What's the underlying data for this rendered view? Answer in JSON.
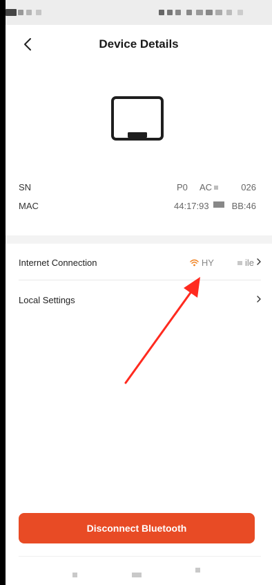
{
  "header": {
    "title": "Device Details",
    "back_icon": "chevron-left-icon"
  },
  "device": {
    "illustration_icon": "display-device-icon",
    "info": [
      {
        "label": "SN",
        "value_prefix": "P0",
        "value_mid": "AC",
        "value_suffix": "026"
      },
      {
        "label": "MAC",
        "value_prefix": "44:17:93",
        "value_suffix": "BB:46"
      }
    ]
  },
  "list": {
    "internet": {
      "label": "Internet Connection",
      "wifi_icon": "wifi-icon",
      "value_prefix": "HY",
      "value_suffix": "ile"
    },
    "local": {
      "label": "Local Settings"
    }
  },
  "actions": {
    "disconnect_label": "Disconnect Bluetooth"
  },
  "colors": {
    "accent": "#e84b25",
    "wifi": "#f0801f",
    "arrow": "#ff2a1f"
  }
}
